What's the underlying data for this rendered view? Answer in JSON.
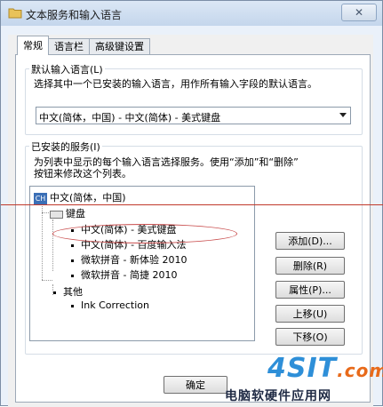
{
  "window": {
    "title": "文本服务和输入语言",
    "close": "✕"
  },
  "tabs": [
    {
      "label": "常规",
      "active": true
    },
    {
      "label": "语言栏",
      "active": false
    },
    {
      "label": "高级键设置",
      "active": false
    }
  ],
  "default_lang": {
    "group_label": "默认输入语言(L)",
    "description": "选择其中一个已安装的输入语言，用作所有输入字段的默认语言。",
    "selected": "中文(简体，中国) - 中文(简体) - 美式键盘"
  },
  "services": {
    "group_label": "已安装的服务(I)",
    "description_line1": "为列表中显示的每个输入语言选择服务。使用“添加”和“删除”",
    "description_line2": "按钮来修改这个列表。",
    "tree": {
      "language_badge": "CH",
      "language": "中文(简体，中国)",
      "keyboard_category": "键盘",
      "keyboards": [
        "中文(简体) - 美式键盘",
        "中文(简体) - 百度输入法",
        "微软拼音 - 新体验 2010",
        "微软拼音 - 简捷 2010"
      ],
      "other_category": "其他",
      "other_items": [
        "Ink Correction"
      ]
    },
    "buttons": {
      "add": "添加(D)...",
      "remove": "删除(R)",
      "properties": "属性(P)...",
      "move_up": "上移(U)",
      "move_down": "下移(O)"
    }
  },
  "footer": {
    "ok": "确定"
  },
  "watermark": {
    "logo_main": "4SIT",
    "logo_suffix": ".com",
    "text": "电脑软硬件应用网"
  },
  "colors": {
    "accent": "#3b6fb6",
    "annotation": "#c84b4b",
    "watermark": "#2e8fd8"
  }
}
